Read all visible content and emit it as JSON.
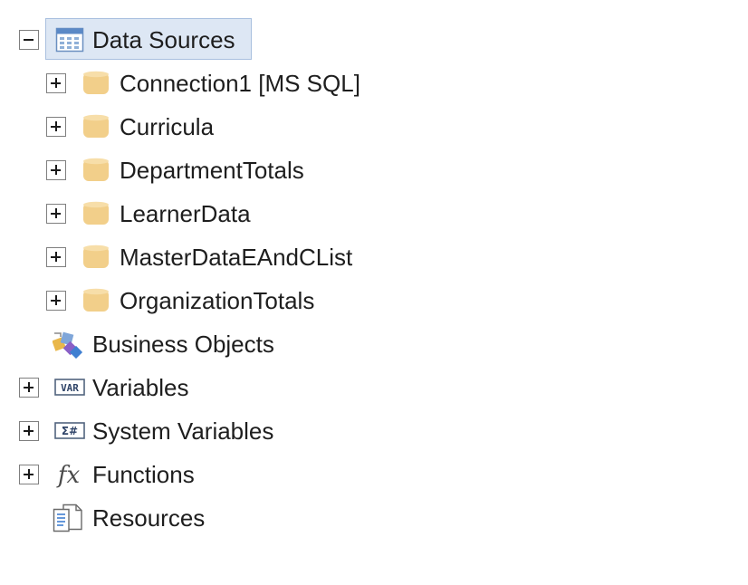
{
  "tree": {
    "root": {
      "label": "Data Sources",
      "icon": "data-sources-icon",
      "expanded": true,
      "selected": true
    },
    "connections": [
      {
        "label": "Connection1 [MS SQL]",
        "icon": "database-icon"
      },
      {
        "label": "Curricula",
        "icon": "database-icon"
      },
      {
        "label": "DepartmentTotals",
        "icon": "database-icon"
      },
      {
        "label": "LearnerData",
        "icon": "database-icon"
      },
      {
        "label": "MasterDataEAndCList",
        "icon": "database-icon"
      },
      {
        "label": "OrganizationTotals",
        "icon": "database-icon"
      }
    ],
    "business_objects": {
      "label": "Business Objects",
      "icon": "business-objects-icon"
    },
    "variables": {
      "label": "Variables",
      "icon": "var-icon",
      "icon_text": "VAR"
    },
    "system_variables": {
      "label": "System Variables",
      "icon": "system-variables-icon",
      "icon_text": "Σ#"
    },
    "functions": {
      "label": "Functions",
      "icon": "fx-icon",
      "icon_text": "fx"
    },
    "resources": {
      "label": "Resources",
      "icon": "resources-icon"
    }
  },
  "colors": {
    "selection_fill": "#dde7f4",
    "selection_border": "#a9c0df",
    "database_icon": "#f2cf8a",
    "text": "#1e1e1e"
  }
}
